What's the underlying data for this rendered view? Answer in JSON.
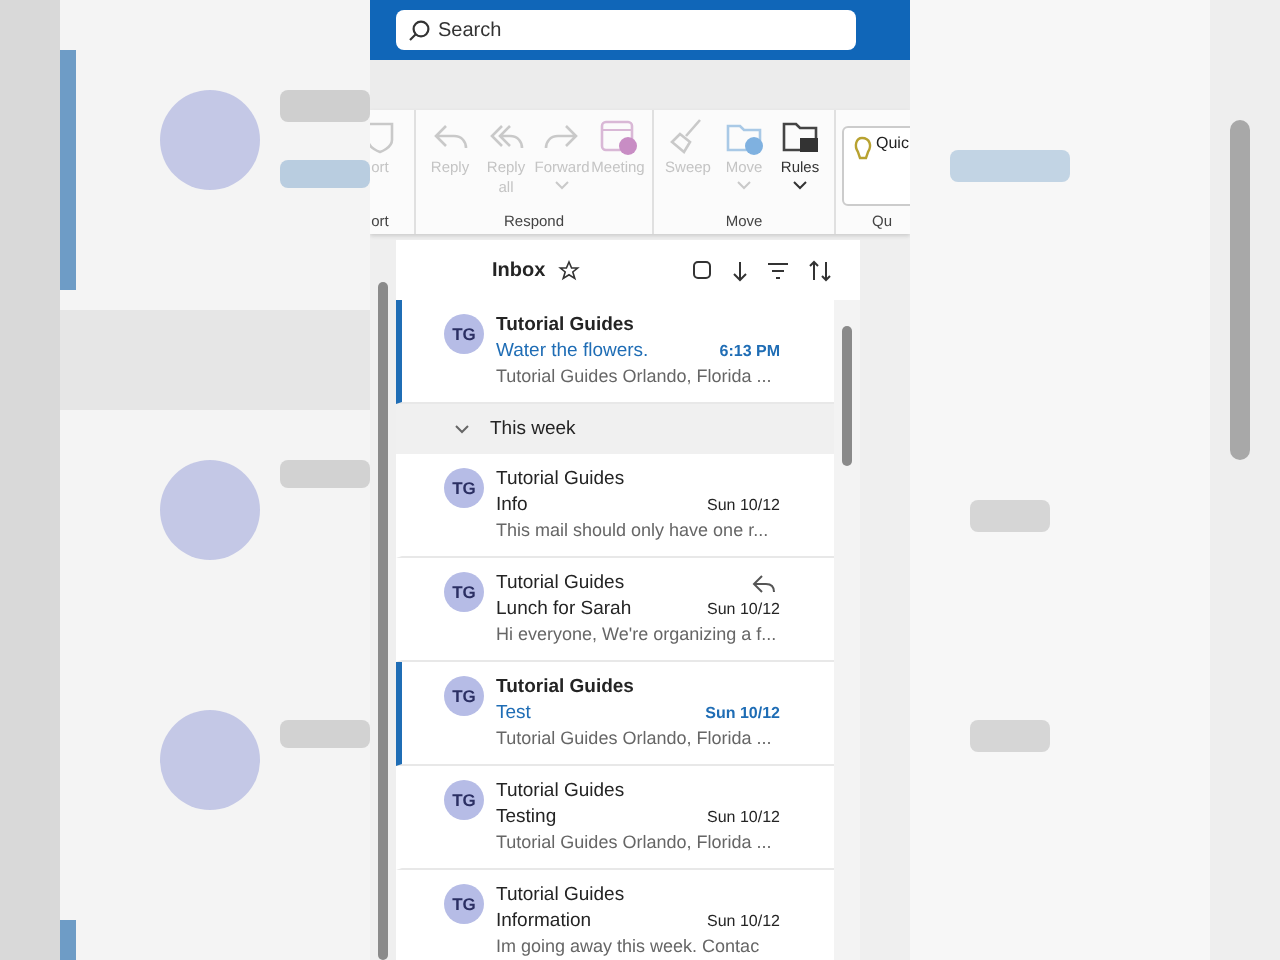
{
  "search": {
    "placeholder": "Search"
  },
  "ribbon": {
    "groups": [
      {
        "label": "ort",
        "buttons": [
          {
            "label": "ort",
            "kind": "shield",
            "disabled": true,
            "dropdown": false
          }
        ]
      },
      {
        "label": "Respond",
        "buttons": [
          {
            "label": "Reply",
            "kind": "reply",
            "disabled": true,
            "dropdown": false
          },
          {
            "label": "Reply all",
            "kind": "replyall",
            "disabled": true,
            "dropdown": false
          },
          {
            "label": "Forward",
            "kind": "forward",
            "disabled": true,
            "dropdown": true
          },
          {
            "label": "Meeting",
            "kind": "meeting",
            "disabled": true,
            "dropdown": false
          }
        ]
      },
      {
        "label": "Move",
        "buttons": [
          {
            "label": "Sweep",
            "kind": "broom",
            "disabled": true,
            "dropdown": false
          },
          {
            "label": "Move",
            "kind": "folder",
            "disabled": true,
            "dropdown": true
          },
          {
            "label": "Rules",
            "kind": "rules",
            "disabled": false,
            "dropdown": true
          }
        ]
      },
      {
        "label": "Qu",
        "buttons": [
          {
            "label": "Quic",
            "kind": "quick"
          }
        ]
      }
    ]
  },
  "list": {
    "title": "Inbox",
    "items": [
      {
        "kind": "mail",
        "sender": "Tutorial Guides",
        "initials": "TG",
        "subject": "Water the flowers.",
        "time": "6:13 PM",
        "preview": "Tutorial Guides Orlando, Florida ...",
        "unread": true,
        "replied": false
      },
      {
        "kind": "group",
        "label": "This week",
        "expanded": true
      },
      {
        "kind": "mail",
        "sender": "Tutorial Guides",
        "initials": "TG",
        "subject": "Info",
        "time": "Sun 10/12",
        "preview": "This mail should only have one r...",
        "unread": false,
        "replied": false
      },
      {
        "kind": "mail",
        "sender": "Tutorial Guides",
        "initials": "TG",
        "subject": "Lunch for Sarah",
        "time": "Sun 10/12",
        "preview": "Hi everyone, We're organizing a f...",
        "unread": false,
        "replied": true
      },
      {
        "kind": "mail",
        "sender": "Tutorial Guides",
        "initials": "TG",
        "subject": "Test",
        "time": "Sun 10/12",
        "preview": "Tutorial Guides Orlando, Florida ...",
        "unread": true,
        "replied": false
      },
      {
        "kind": "mail",
        "sender": "Tutorial Guides",
        "initials": "TG",
        "subject": "Testing",
        "time": "Sun 10/12",
        "preview": "Tutorial Guides Orlando, Florida ...",
        "unread": false,
        "replied": false
      },
      {
        "kind": "mail",
        "sender": "Tutorial Guides",
        "initials": "TG",
        "subject": "Information",
        "time": "Sun 10/12",
        "preview": "Im going away this week. Contac",
        "unread": false,
        "replied": false
      }
    ]
  }
}
